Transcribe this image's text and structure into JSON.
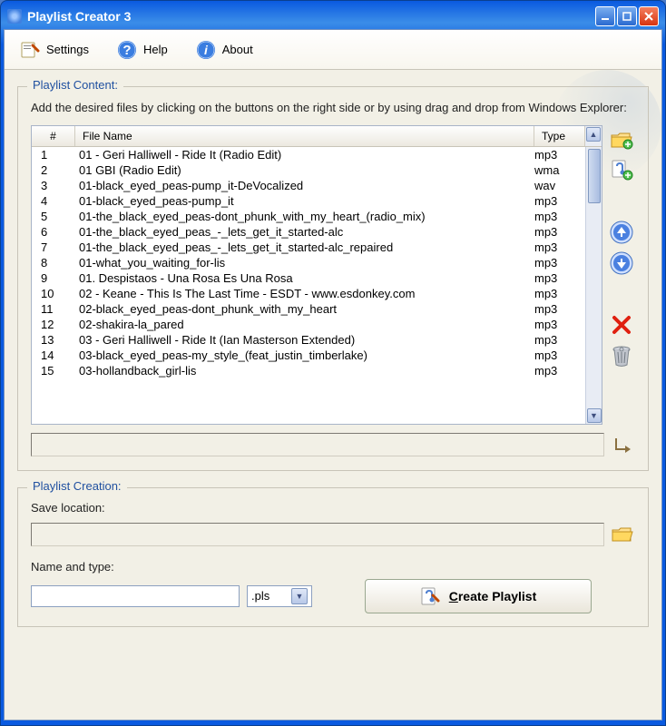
{
  "window": {
    "title": "Playlist Creator 3"
  },
  "toolbar": {
    "settings": "Settings",
    "help": "Help",
    "about": "About"
  },
  "playlist_content": {
    "legend": "Playlist Content:",
    "instruction": "Add the desired files by clicking on the buttons on the right side or by using drag and drop from Windows Explorer:",
    "columns": {
      "num": "#",
      "name": "File Name",
      "type": "Type"
    },
    "rows": [
      {
        "n": "1",
        "name": "01 - Geri Halliwell - Ride It (Radio Edit)",
        "type": "mp3"
      },
      {
        "n": "2",
        "name": "01 GBI (Radio Edit)",
        "type": "wma"
      },
      {
        "n": "3",
        "name": "01-black_eyed_peas-pump_it-DeVocalized",
        "type": "wav"
      },
      {
        "n": "4",
        "name": "01-black_eyed_peas-pump_it",
        "type": "mp3"
      },
      {
        "n": "5",
        "name": "01-the_black_eyed_peas-dont_phunk_with_my_heart_(radio_mix)",
        "type": "mp3"
      },
      {
        "n": "6",
        "name": "01-the_black_eyed_peas_-_lets_get_it_started-alc",
        "type": "mp3"
      },
      {
        "n": "7",
        "name": "01-the_black_eyed_peas_-_lets_get_it_started-alc_repaired",
        "type": "mp3"
      },
      {
        "n": "8",
        "name": "01-what_you_waiting_for-lis",
        "type": "mp3"
      },
      {
        "n": "9",
        "name": "01. Despistaos - Una Rosa Es Una Rosa",
        "type": "mp3"
      },
      {
        "n": "10",
        "name": "02 - Keane - This Is The Last Time - ESDT - www.esdonkey.com",
        "type": "mp3"
      },
      {
        "n": "11",
        "name": "02-black_eyed_peas-dont_phunk_with_my_heart",
        "type": "mp3"
      },
      {
        "n": "12",
        "name": "02-shakira-la_pared",
        "type": "mp3"
      },
      {
        "n": "13",
        "name": "03 - Geri Halliwell - Ride It  (Ian Masterson Extended)",
        "type": "mp3"
      },
      {
        "n": "14",
        "name": "03-black_eyed_peas-my_style_(feat_justin_timberlake)",
        "type": "mp3"
      },
      {
        "n": "15",
        "name": "03-hollandback_girl-lis",
        "type": "mp3"
      }
    ],
    "path_value": ""
  },
  "playlist_creation": {
    "legend": "Playlist Creation:",
    "save_label": "Save location:",
    "save_value": "",
    "name_label": "Name and type:",
    "name_value": "",
    "type_value": ".pls",
    "create_label_prefix": "C",
    "create_label_rest": "reate Playlist"
  }
}
